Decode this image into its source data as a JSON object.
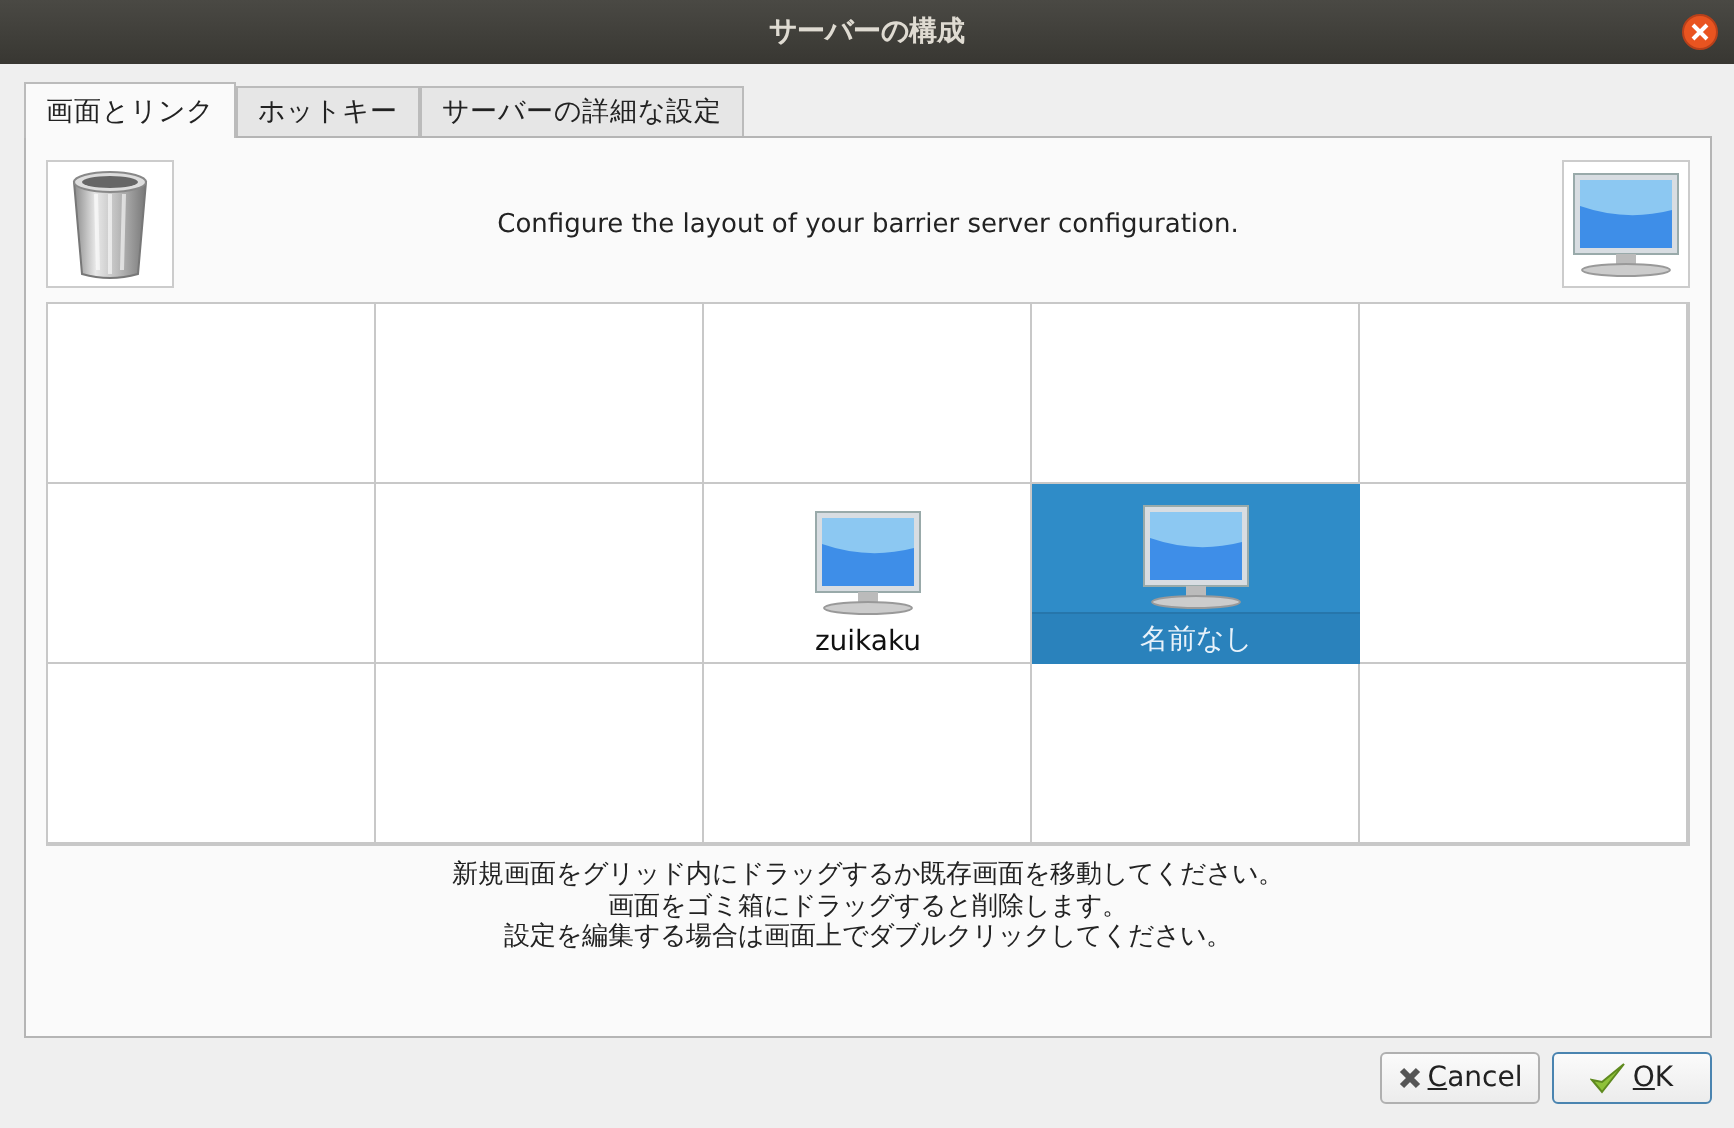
{
  "window": {
    "title": "サーバーの構成"
  },
  "tabs": [
    {
      "label": "画面とリンク",
      "selected": true
    },
    {
      "label": "ホットキー",
      "selected": false
    },
    {
      "label": "サーバーの詳細な設定",
      "selected": false
    }
  ],
  "header": {
    "text": "Configure the layout of your barrier server configuration."
  },
  "grid": {
    "cells": [
      {},
      {},
      {},
      {},
      {},
      {},
      {},
      {
        "screen": {
          "name": "zuikaku",
          "selected": false
        }
      },
      {
        "screen": {
          "name": "名前なし",
          "selected": true
        }
      },
      {},
      {},
      {},
      {},
      {},
      {}
    ]
  },
  "instructions": [
    "新規画面をグリッド内にドラッグするか既存画面を移動してください。",
    "画面をゴミ箱にドラッグすると削除します。",
    "設定を編集する場合は画面上でダブルクリックしてください。"
  ],
  "buttons": [
    {
      "kind": "cancel",
      "accel": "C",
      "rest": "ancel"
    },
    {
      "kind": "ok",
      "accel": "O",
      "rest": "K"
    }
  ]
}
